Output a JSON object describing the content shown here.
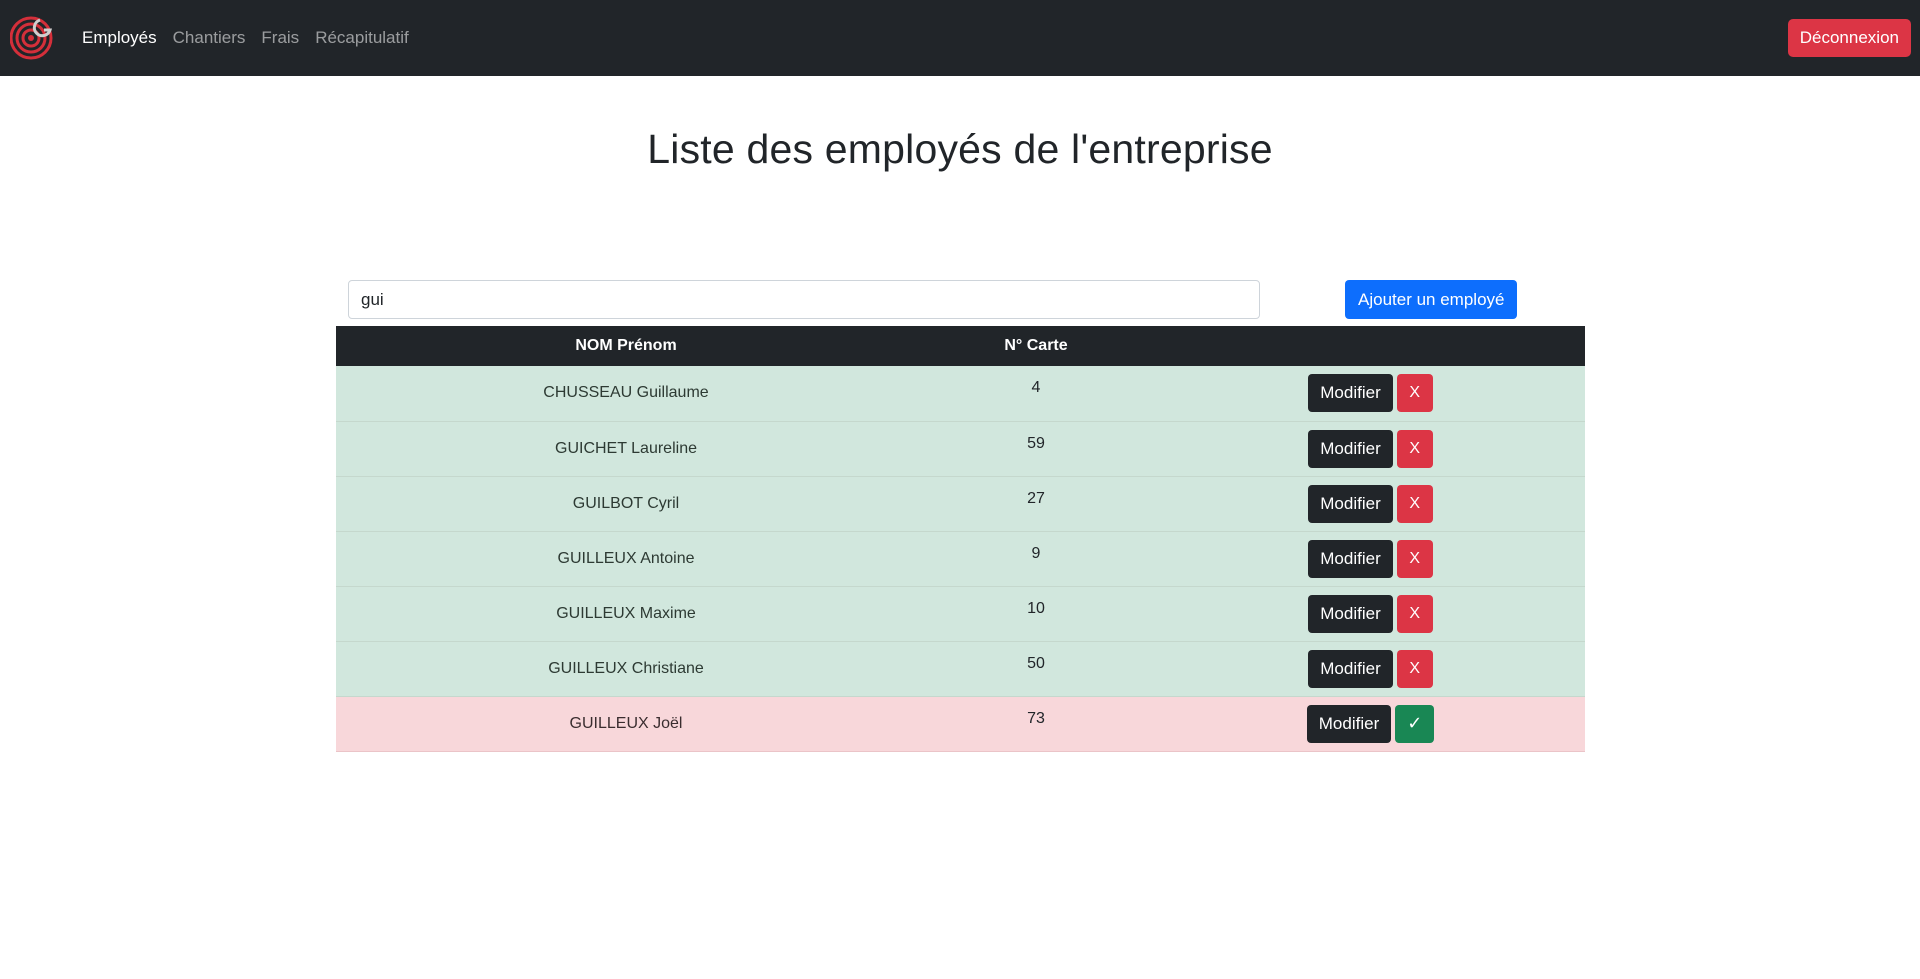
{
  "navbar": {
    "logo_icon": "company-logo-target",
    "links": [
      {
        "label": "Employés",
        "active": true
      },
      {
        "label": "Chantiers",
        "active": false
      },
      {
        "label": "Frais",
        "active": false
      },
      {
        "label": "Récapitulatif",
        "active": false
      }
    ],
    "logout_label": "Déconnexion"
  },
  "main": {
    "title": "Liste des employés de l'entreprise",
    "search": {
      "value": "gui",
      "placeholder": ""
    },
    "add_label": "Ajouter un employé"
  },
  "table": {
    "headers": [
      "NOM Prénom",
      "N° Carte",
      ""
    ],
    "modify_label": "Modifier",
    "delete_label": "X",
    "activate_label": "✓",
    "rows": [
      {
        "name": "CHUSSEAU Guillaume",
        "card": "4",
        "status": "active"
      },
      {
        "name": "GUICHET Laureline",
        "card": "59",
        "status": "active"
      },
      {
        "name": "GUILBOT Cyril",
        "card": "27",
        "status": "active"
      },
      {
        "name": "GUILLEUX Antoine",
        "card": "9",
        "status": "active"
      },
      {
        "name": "GUILLEUX Maxime",
        "card": "10",
        "status": "active"
      },
      {
        "name": "GUILLEUX Christiane",
        "card": "50",
        "status": "active"
      },
      {
        "name": "GUILLEUX Joël",
        "card": "73",
        "status": "inactive"
      }
    ]
  },
  "colors": {
    "navbar": "#212529",
    "primary": "#0d6efd",
    "danger": "#dc3545",
    "success": "#198754",
    "row_active": "#d1e7dd",
    "row_inactive": "#f8d7da"
  }
}
